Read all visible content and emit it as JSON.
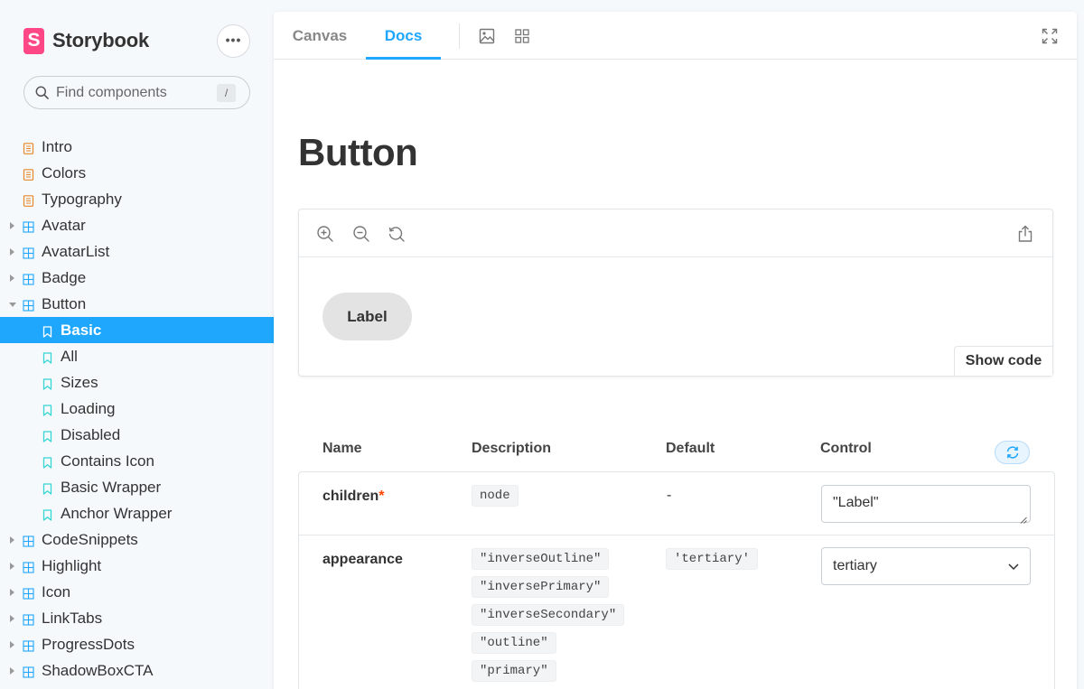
{
  "sidebar": {
    "brand": "Storybook",
    "brand_logo_letter": "S",
    "menu_label": "•••",
    "search": {
      "placeholder": "Find components",
      "shortcut": "/"
    },
    "items": [
      {
        "label": "Intro",
        "kind": "doc"
      },
      {
        "label": "Colors",
        "kind": "doc"
      },
      {
        "label": "Typography",
        "kind": "doc"
      },
      {
        "label": "Avatar",
        "kind": "component"
      },
      {
        "label": "AvatarList",
        "kind": "component"
      },
      {
        "label": "Badge",
        "kind": "component"
      },
      {
        "label": "Button",
        "kind": "component",
        "expanded": true
      },
      {
        "label": "Basic",
        "kind": "story",
        "selected": true
      },
      {
        "label": "All",
        "kind": "story"
      },
      {
        "label": "Sizes",
        "kind": "story"
      },
      {
        "label": "Loading",
        "kind": "story"
      },
      {
        "label": "Disabled",
        "kind": "story"
      },
      {
        "label": "Contains Icon",
        "kind": "story"
      },
      {
        "label": "Basic Wrapper",
        "kind": "story"
      },
      {
        "label": "Anchor Wrapper",
        "kind": "story"
      },
      {
        "label": "CodeSnippets",
        "kind": "component"
      },
      {
        "label": "Highlight",
        "kind": "component"
      },
      {
        "label": "Icon",
        "kind": "component"
      },
      {
        "label": "LinkTabs",
        "kind": "component"
      },
      {
        "label": "ProgressDots",
        "kind": "component"
      },
      {
        "label": "ShadowBoxCTA",
        "kind": "component"
      }
    ]
  },
  "toolbar": {
    "tabs": [
      {
        "label": "Canvas"
      },
      {
        "label": "Docs",
        "active": true
      }
    ]
  },
  "docs": {
    "title": "Button",
    "preview": {
      "button_label": "Label",
      "show_code": "Show code"
    },
    "args": {
      "headers": {
        "name": "Name",
        "description": "Description",
        "default": "Default",
        "control": "Control"
      },
      "rows": [
        {
          "name": "children",
          "required": "*",
          "type": "node",
          "default": "-",
          "control_value": "\"Label\""
        },
        {
          "name": "appearance",
          "options": [
            "\"inverseOutline\"",
            "\"inversePrimary\"",
            "\"inverseSecondary\"",
            "\"outline\"",
            "\"primary\""
          ],
          "default": "'tertiary'",
          "control_value": "tertiary"
        }
      ]
    }
  },
  "colors": {
    "accent": "#1ea7fd",
    "brand": "#ff4785",
    "doc_icon": "#e6882a",
    "story_icon": "#37d5d3"
  }
}
